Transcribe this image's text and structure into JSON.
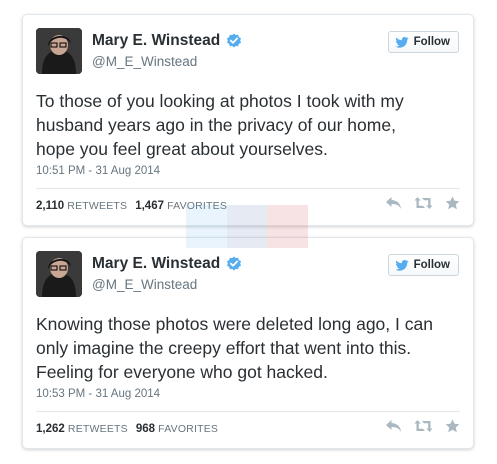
{
  "tweets": [
    {
      "display_name": "Mary E. Winstead",
      "handle": "@M_E_Winstead",
      "follow_label": "Follow",
      "text": "To those of you looking at photos I took with my\nhusband years ago in the privacy of our home,\nhope you feel great about yourselves.",
      "timestamp": "10:51 PM - 31 Aug 2014",
      "retweets": "2,110",
      "retweets_label": "RETWEETS",
      "favorites": "1,467",
      "favorites_label": "FAVORITES"
    },
    {
      "display_name": "Mary E. Winstead",
      "handle": "@M_E_Winstead",
      "follow_label": "Follow",
      "text": "Knowing those photos were deleted long ago, I can\nonly imagine the creepy effort that went into this.\nFeeling for everyone who got hacked.",
      "timestamp": "10:53 PM - 31 Aug 2014",
      "retweets": "1,262",
      "retweets_label": "RETWEETS",
      "favorites": "968",
      "favorites_label": "FAVORITES"
    }
  ],
  "icons": {
    "verified": "verified-badge-icon",
    "follow": "twitter-bird-icon",
    "reply": "reply-icon",
    "retweet": "retweet-icon",
    "favorite": "star-icon"
  },
  "colors": {
    "verified": "#55acee",
    "bird": "#55acee",
    "text": "#292f33",
    "muted": "#66757f",
    "action_icon": "#aab8c2",
    "watermark_twitter": "#55acee",
    "watermark_facebook": "#3b5998",
    "watermark_pinterest": "#cb2027"
  }
}
